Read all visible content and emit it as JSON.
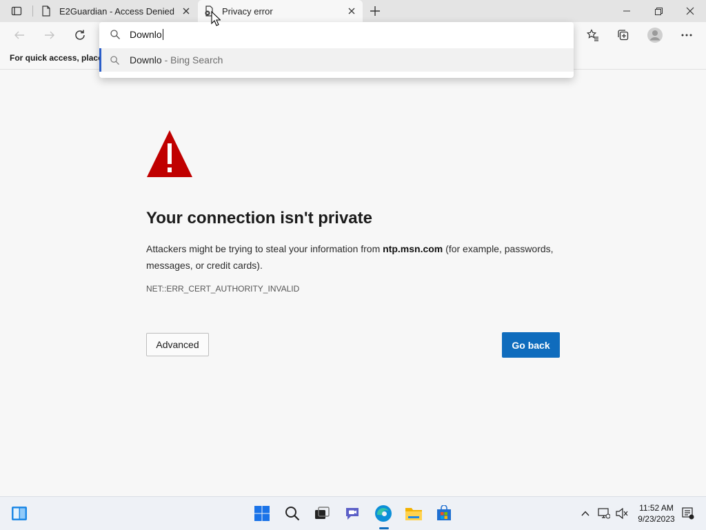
{
  "tabs": [
    {
      "title": "E2Guardian - Access Denied",
      "active": false
    },
    {
      "title": "Privacy error",
      "active": true
    }
  ],
  "omnibox": {
    "query": "Downlo",
    "suggestion_text": "Downlo",
    "suggestion_suffix": " - Bing Search"
  },
  "favorites_bar": {
    "text": "For quick access, place y"
  },
  "error_page": {
    "heading": "Your connection isn't private",
    "desc_before": "Attackers might be trying to steal your information from ",
    "domain": "ntp.msn.com",
    "desc_after": " (for example, passwords, messages, or credit cards).",
    "error_code": "NET::ERR_CERT_AUTHORITY_INVALID",
    "advanced_label": "Advanced",
    "go_back_label": "Go back"
  },
  "taskbar": {
    "time": "11:52 AM",
    "date": "9/23/2023"
  },
  "colors": {
    "accent": "#0f6cbd",
    "warning": "#c00000"
  }
}
